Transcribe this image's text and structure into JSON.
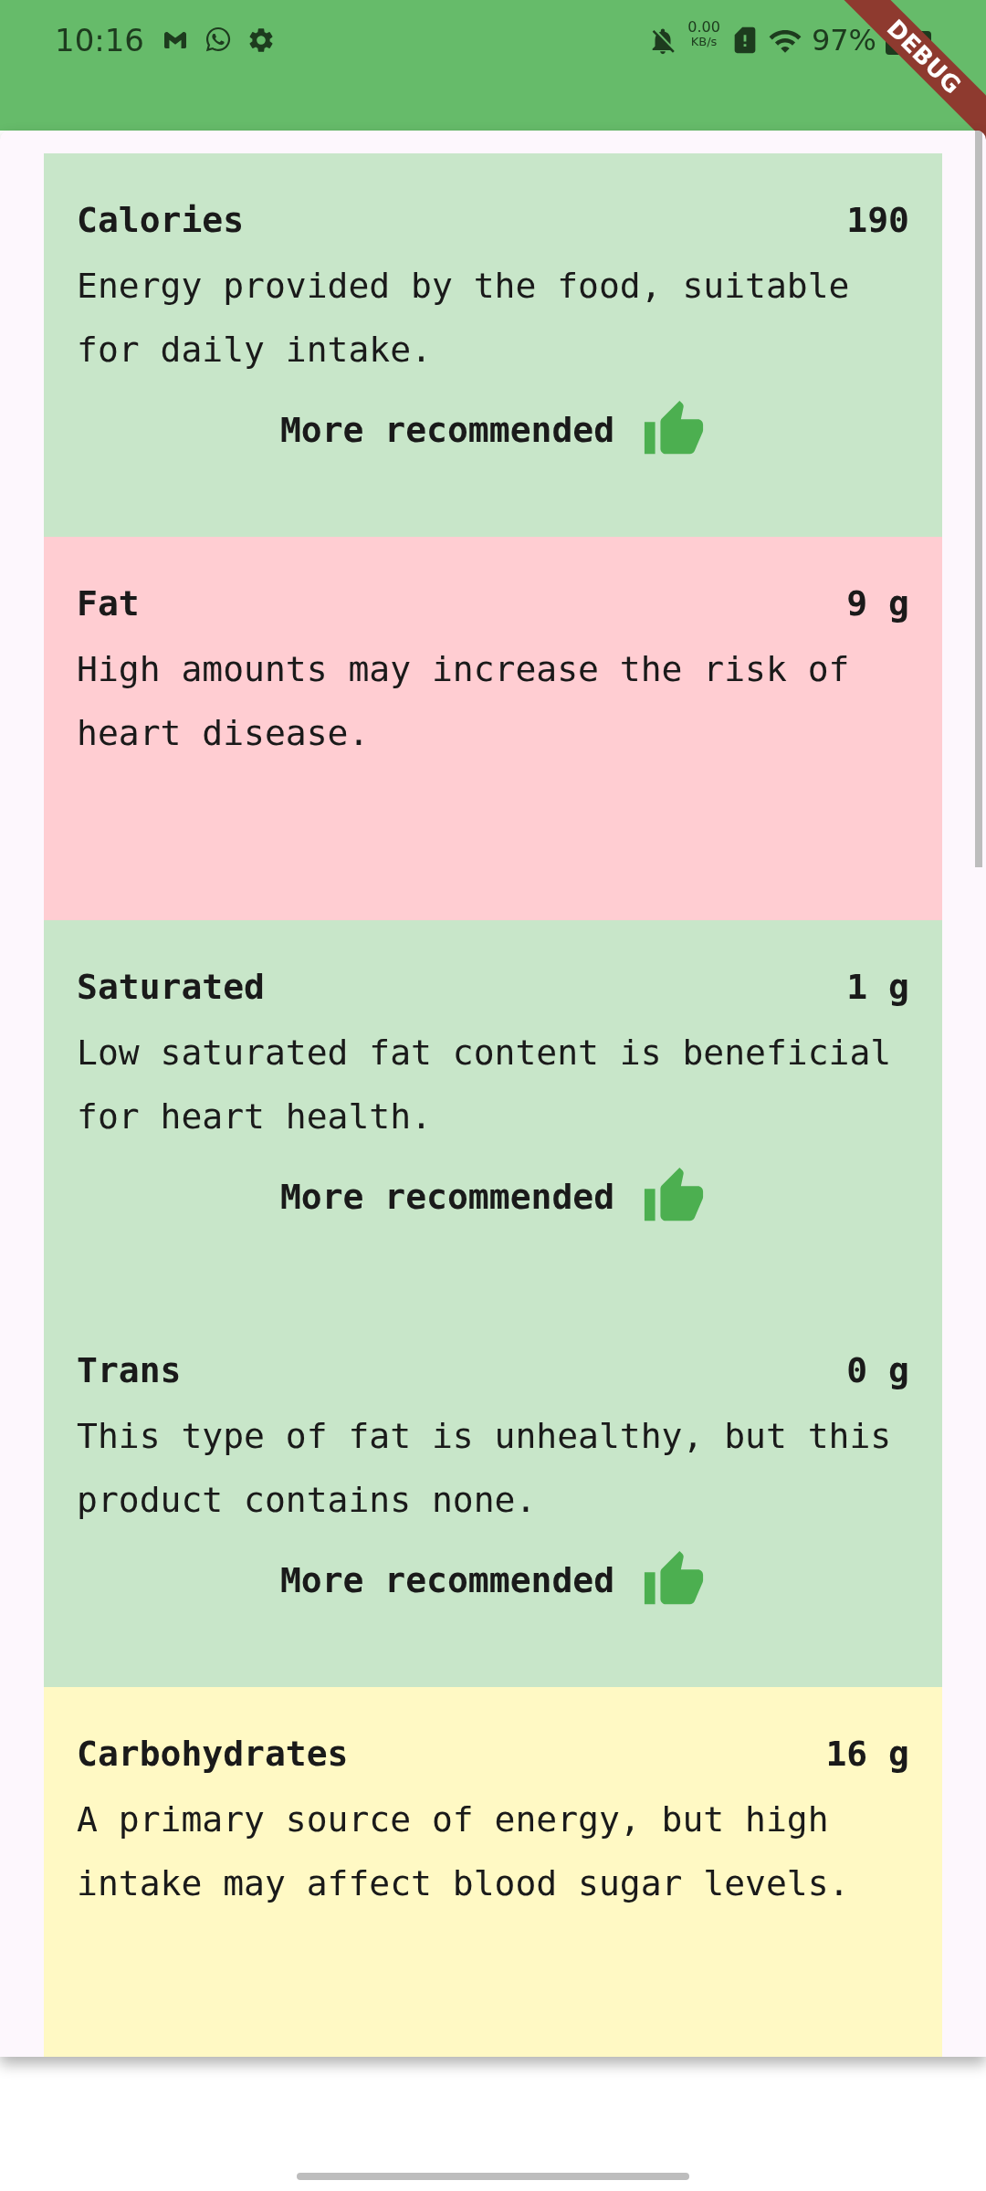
{
  "status_bar": {
    "time": "10:16",
    "net_speed": "0.00",
    "net_unit": "KB/s",
    "battery": "97%"
  },
  "debug_banner": "DEBUG",
  "nutrients": [
    {
      "name": "Calories",
      "amount": "190",
      "description": "Energy provided by the food, suitable for daily intake.",
      "color": "#c8e6c9",
      "recommendation": "More recommended"
    },
    {
      "name": "Fat",
      "amount": "9 g",
      "description": "High amounts may increase the risk of heart disease.",
      "color": "#ffcdd2"
    },
    {
      "name": "Saturated",
      "amount": "1 g",
      "description": "Low saturated fat content is beneficial for heart health.",
      "color": "#c8e6c9",
      "recommendation": "More recommended"
    },
    {
      "name": "Trans",
      "amount": "0 g",
      "description": "This type of fat is unhealthy, but this product contains none.",
      "color": "#c8e6c9",
      "recommendation": "More recommended"
    },
    {
      "name": "Carbohydrates",
      "amount": "16 g",
      "description": "A primary source of energy, but high intake may affect blood sugar levels.",
      "color": "#fff9c4"
    }
  ]
}
